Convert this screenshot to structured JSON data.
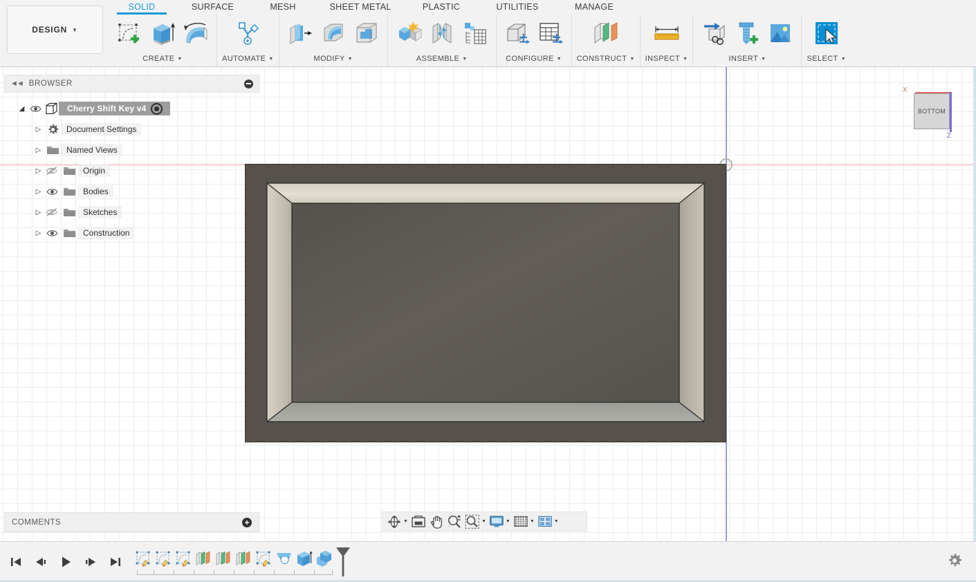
{
  "app": {
    "design_button": "DESIGN",
    "design_caret": "▼"
  },
  "ribbon": {
    "tabs": [
      {
        "label": "SOLID",
        "active": true
      },
      {
        "label": "SURFACE",
        "active": false
      },
      {
        "label": "MESH",
        "active": false
      },
      {
        "label": "SHEET METAL",
        "active": false
      },
      {
        "label": "PLASTIC",
        "active": false
      },
      {
        "label": "UTILITIES",
        "active": false
      },
      {
        "label": "MANAGE",
        "active": false
      }
    ],
    "panels": [
      {
        "label": "CREATE",
        "caret": "▼",
        "icons": [
          "create-sketch-icon",
          "extrude-icon",
          "revolve-icon"
        ]
      },
      {
        "label": "AUTOMATE",
        "caret": "▼",
        "icons": [
          "automate-icon"
        ]
      },
      {
        "label": "MODIFY",
        "caret": "▼",
        "icons": [
          "press-pull-icon",
          "fillet-icon",
          "shell-icon"
        ]
      },
      {
        "label": "ASSEMBLE",
        "caret": "▼",
        "icons": [
          "new-component-icon",
          "joint-icon",
          "assemble-table-icon"
        ]
      },
      {
        "label": "CONFIGURE",
        "caret": "▼",
        "icons": [
          "configure-part-icon",
          "configure-table-icon"
        ]
      },
      {
        "label": "CONSTRUCT",
        "caret": "▼",
        "icons": [
          "construct-plane-icon"
        ]
      },
      {
        "label": "INSPECT",
        "caret": "▼",
        "icons": [
          "measure-icon"
        ]
      },
      {
        "label": "INSERT",
        "caret": "▼",
        "icons": [
          "insert-derive-icon",
          "insert-mcmaster-icon",
          "insert-decal-icon"
        ]
      },
      {
        "label": "SELECT",
        "caret": "▼",
        "icons": [
          "select-icon"
        ]
      }
    ]
  },
  "browser": {
    "title": "BROWSER",
    "collapse_glyph": "◄◄",
    "tree": [
      {
        "label": "Cherry Shift Key v4",
        "arrow": "◢",
        "eye": "visible",
        "icon": "component-icon",
        "selected": true,
        "indent": 0
      },
      {
        "label": "Document Settings",
        "arrow": "▷",
        "eye": "none",
        "icon": "gear-icon",
        "selected": false,
        "indent": 1
      },
      {
        "label": "Named Views",
        "arrow": "▷",
        "eye": "none",
        "icon": "folder-icon",
        "selected": false,
        "indent": 1
      },
      {
        "label": "Origin",
        "arrow": "▷",
        "eye": "hidden",
        "icon": "folder-icon",
        "selected": false,
        "indent": 1
      },
      {
        "label": "Bodies",
        "arrow": "▷",
        "eye": "visible",
        "icon": "folder-icon",
        "selected": false,
        "indent": 1
      },
      {
        "label": "Sketches",
        "arrow": "▷",
        "eye": "hidden",
        "icon": "folder-icon",
        "selected": false,
        "indent": 1
      },
      {
        "label": "Construction",
        "arrow": "▷",
        "eye": "visible",
        "icon": "folder-icon",
        "selected": false,
        "indent": 1
      }
    ]
  },
  "comments": {
    "title": "COMMENTS",
    "add_glyph": "+"
  },
  "viewcube": {
    "face_label": "BOTTOM",
    "x_label": "X",
    "z_label": "Z",
    "x_color": "#d9706f",
    "z_color": "#7b6fd4"
  },
  "navbar": {
    "items": [
      {
        "name": "orbit-icon",
        "caret": "▼"
      },
      {
        "name": "look-at-icon",
        "caret": ""
      },
      {
        "name": "pan-icon",
        "caret": ""
      },
      {
        "name": "zoom-icon",
        "caret": ""
      },
      {
        "name": "zoom-window-icon",
        "caret": "▼"
      },
      {
        "name": "display-settings-icon",
        "caret": "▼"
      },
      {
        "name": "grid-snaps-icon",
        "caret": "▼"
      },
      {
        "name": "viewports-icon",
        "caret": "▼"
      }
    ]
  },
  "timeline": {
    "playback": [
      {
        "name": "go-to-beginning-button",
        "glyph": "skip-back"
      },
      {
        "name": "step-back-button",
        "glyph": "step-back"
      },
      {
        "name": "play-button",
        "glyph": "play"
      },
      {
        "name": "step-forward-button",
        "glyph": "step-forward"
      },
      {
        "name": "go-to-end-button",
        "glyph": "skip-end"
      }
    ],
    "features": [
      {
        "name": "timeline-sketch-1",
        "type": "sketch"
      },
      {
        "name": "timeline-sketch-2",
        "type": "sketch"
      },
      {
        "name": "timeline-sketch-3",
        "type": "sketch"
      },
      {
        "name": "timeline-plane-1",
        "type": "plane"
      },
      {
        "name": "timeline-plane-2",
        "type": "plane"
      },
      {
        "name": "timeline-plane-3",
        "type": "plane"
      },
      {
        "name": "timeline-sketch-4",
        "type": "sketch"
      },
      {
        "name": "timeline-loft-1",
        "type": "loft"
      },
      {
        "name": "timeline-extrude-1",
        "type": "extrude"
      },
      {
        "name": "timeline-combine-1",
        "type": "combine"
      }
    ],
    "settings_icon": "gear-icon"
  },
  "model": {
    "name": "hollow-box-shell",
    "colors": {
      "outer_rim": "#56524b",
      "top_inner": "#ddd8c9",
      "side_inner_left": "#c9c4b6",
      "side_inner_right": "#b9b5a8",
      "back_face": "#5b5852",
      "floor": "#a8a9a2",
      "edge": "#262626"
    }
  },
  "canvas": {
    "grid_minor_color": "#ececec",
    "grid_major_color": "#dadada",
    "x_axis_color": "#e8a8a8",
    "y_axis_color": "#9b9bdc",
    "background": "#ffffff"
  }
}
